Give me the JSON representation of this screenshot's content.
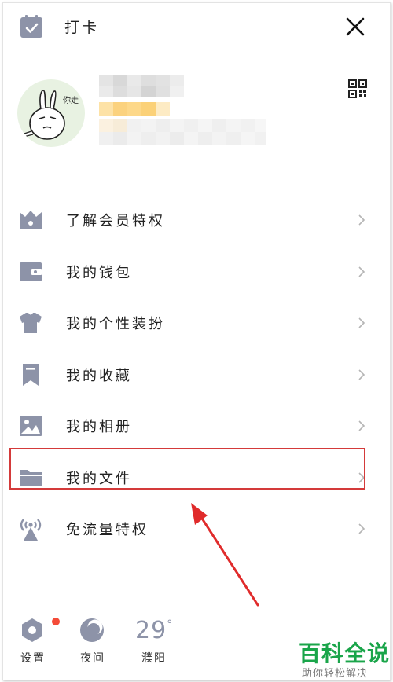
{
  "header": {
    "checkin_label": "打卡"
  },
  "menu": {
    "items": [
      {
        "label": "了解会员特权",
        "icon": "crown-icon"
      },
      {
        "label": "我的钱包",
        "icon": "wallet-icon"
      },
      {
        "label": "我的个性装扮",
        "icon": "shirt-icon"
      },
      {
        "label": "我的收藏",
        "icon": "bookmark-icon"
      },
      {
        "label": "我的相册",
        "icon": "photo-icon"
      },
      {
        "label": "我的文件",
        "icon": "folder-icon",
        "highlighted": true
      },
      {
        "label": "免流量特权",
        "icon": "antenna-icon"
      }
    ]
  },
  "bottom": {
    "settings_label": "设置",
    "night_label": "夜间",
    "weather_label": "濮阳",
    "temperature": "29",
    "temperature_unit": "°"
  },
  "watermark": {
    "title": "百科全说",
    "subtitle": "助你轻松解决"
  },
  "colors": {
    "icon_gray": "#8d93a8",
    "highlight_red": "#d43a3a",
    "badge_red": "#f44b38",
    "watermark_green": "#1aa54a"
  }
}
